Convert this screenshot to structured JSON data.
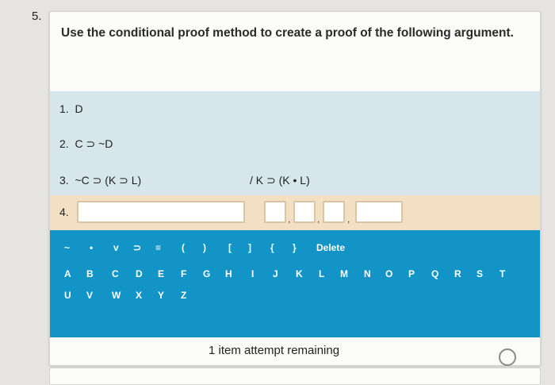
{
  "question_number": "5.",
  "prompt": "Use the conditional proof method to create a proof of the following argument.",
  "premises": [
    {
      "num": "1.",
      "formula": "D"
    },
    {
      "num": "2.",
      "formula": "C ⊃ ~D"
    },
    {
      "num": "3.",
      "formula": "~C ⊃ (K ⊃ L)"
    }
  ],
  "conclusion": "/ K ⊃ (K • L)",
  "answer_line": {
    "num": "4.",
    "main_value": "",
    "justification_values": [
      "",
      "",
      "",
      ""
    ]
  },
  "symbol_keys": [
    "~",
    "•",
    "v",
    "⊃",
    "≡",
    "(",
    ")",
    "[",
    "]",
    "{",
    "}",
    "Delete"
  ],
  "letter_keys_row1": [
    "A",
    "B",
    "C",
    "D",
    "E",
    "F",
    "G",
    "H",
    "I",
    "J",
    "K",
    "L",
    "M",
    "N",
    "O",
    "P",
    "Q",
    "R",
    "S",
    "T"
  ],
  "letter_keys_row2": [
    "U",
    "V",
    "W",
    "X",
    "Y",
    "Z"
  ],
  "attempts_text": "1 item attempt remaining",
  "colors": {
    "premise_bg": "#d6e6ea",
    "answer_bg": "#f3e0c4",
    "keyboard_bg": "#1294c6"
  }
}
